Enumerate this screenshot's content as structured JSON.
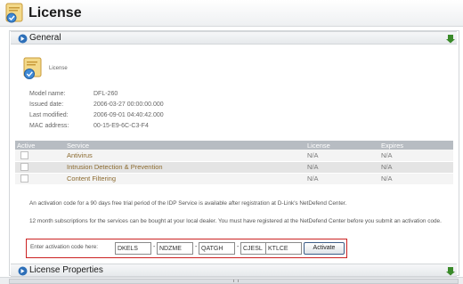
{
  "header": {
    "title": "License",
    "icon": "license-certificate-icon"
  },
  "general": {
    "section_title": "General",
    "icon_label": "License",
    "info": [
      {
        "label": "Model name:",
        "value": "DFL-260"
      },
      {
        "label": "Issued date:",
        "value": "2006-03-27 00:00:00.000"
      },
      {
        "label": "Last modified:",
        "value": "2006-09-01 04:40:42.000"
      },
      {
        "label": "MAC address:",
        "value": "00-15-E9-6C-C3-F4"
      }
    ],
    "table": {
      "headers": [
        "Active",
        "Service",
        "License",
        "Expires"
      ],
      "rows": [
        {
          "service": "Antivirus",
          "license": "N/A",
          "expires": "N/A"
        },
        {
          "service": "Intrusion Detection & Prevention",
          "license": "N/A",
          "expires": "N/A"
        },
        {
          "service": "Content Filtering",
          "license": "N/A",
          "expires": "N/A"
        }
      ]
    },
    "para1": "An activation code for a 90 days free trial period of the IDP Service is available after registration at D-Link's NetDefend Center.",
    "para2": "12 month subscriptions for the services can be bought at your local dealer. You must have registered at the NetDefend Center before you submit an activation code.",
    "activation": {
      "label": "Enter activation code here:",
      "codes": [
        "DKELS",
        "NDZME",
        "QATGH",
        "CJESL",
        "KTLCE"
      ],
      "button": "Activate"
    }
  },
  "license_properties": {
    "section_title": "License Properties"
  },
  "colors": {
    "accent": "#3a8a2a",
    "highlight_border": "#cc2222",
    "table_header": "#b7bcc2",
    "service_text": "#8b6a2f"
  }
}
